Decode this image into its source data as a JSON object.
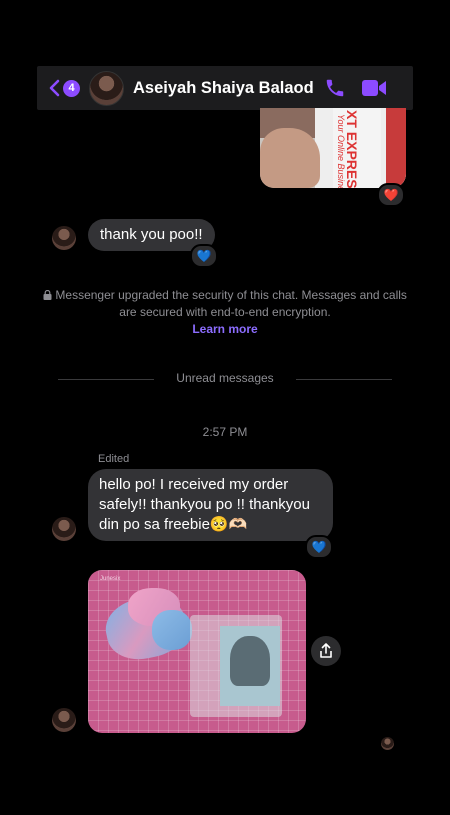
{
  "header": {
    "unread_count": "4",
    "contact_name": "Aseiyah Shaiya Balaod",
    "back_icon": "chevron-left-icon",
    "call_icon": "phone-icon",
    "video_icon": "video-camera-icon",
    "accent_color": "#8c4bff"
  },
  "photo_top": {
    "brand_text": "XT EXPRESS",
    "brand_subtext": "Your Online Business",
    "reaction": "❤️"
  },
  "message_1": {
    "text": "thank you poo!!",
    "reaction": "💙"
  },
  "security_notice": {
    "text": "Messenger upgraded the security of this chat. Messages and calls are secured with end-to-end encryption.",
    "link": "Learn more",
    "lock_icon": "lock-icon"
  },
  "unread_divider": "Unread messages",
  "timestamp": "2:57 PM",
  "message_2": {
    "edited_label": "Edited",
    "text": "hello po! I received my order safely!! thankyou po !! thankyou din po sa freebie🥺🫶🏻",
    "reaction": "💙"
  },
  "photo_bottom": {
    "brand_text": "Junesix",
    "share_icon": "share-icon"
  }
}
